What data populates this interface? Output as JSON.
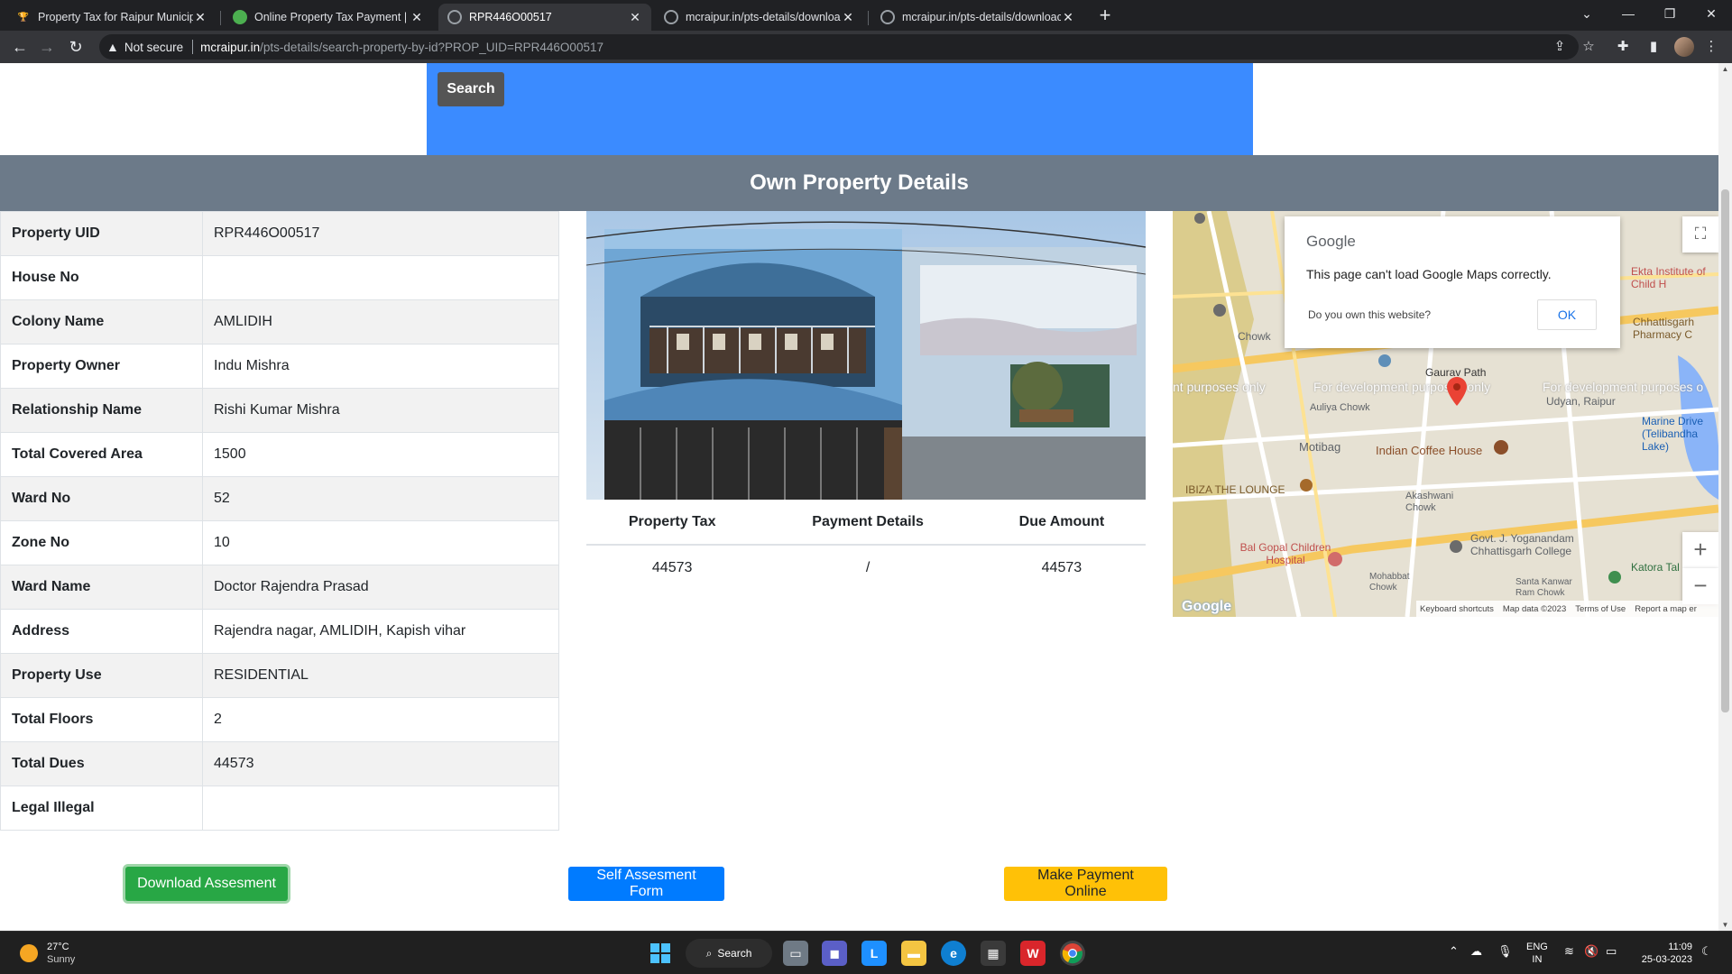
{
  "browser": {
    "tabs": [
      {
        "title": "Property Tax for Raipur Municipa",
        "active": false
      },
      {
        "title": "Online Property Tax Payment | D",
        "active": false
      },
      {
        "title": "RPR446O00517",
        "active": true
      },
      {
        "title": "mcraipur.in/pts-details/downloac",
        "active": false
      },
      {
        "title": "mcraipur.in/pts-details/downloac",
        "active": false
      }
    ],
    "security_label": "Not secure",
    "url_host": "mcraipur.in",
    "url_path": "/pts-details/search-property-by-id?PROP_UID=RPR446O00517"
  },
  "search": {
    "button_label": "Search"
  },
  "section_title": "Own Property Details",
  "details": [
    {
      "label": "Property UID",
      "value": "RPR446O00517"
    },
    {
      "label": "House No",
      "value": ""
    },
    {
      "label": "Colony Name",
      "value": "AMLIDIH"
    },
    {
      "label": "Property Owner",
      "value": "Indu Mishra"
    },
    {
      "label": "Relationship Name",
      "value": "Rishi Kumar Mishra"
    },
    {
      "label": "Total Covered Area",
      "value": "1500"
    },
    {
      "label": "Ward No",
      "value": "52"
    },
    {
      "label": "Zone No",
      "value": "10"
    },
    {
      "label": "Ward Name",
      "value": "Doctor Rajendra Prasad"
    },
    {
      "label": "Address",
      "value": "Rajendra nagar, AMLIDIH, Kapish vihar"
    },
    {
      "label": "Property Use",
      "value": "RESIDENTIAL"
    },
    {
      "label": "Total Floors",
      "value": "2"
    },
    {
      "label": "Total Dues",
      "value": "44573"
    },
    {
      "label": "Legal Illegal",
      "value": ""
    }
  ],
  "tax_table": {
    "headers": [
      "Property Tax",
      "Payment Details",
      "Due Amount"
    ],
    "row": [
      "44573",
      "/",
      "44573"
    ]
  },
  "map": {
    "dialog_brand": "Google",
    "dialog_message": "This page can't load Google Maps correctly.",
    "dialog_question": "Do you own this website?",
    "dialog_ok": "OK",
    "dev_text_1": "nt purposes only",
    "dev_text_2": "For development purposes only",
    "dev_text_3": "For development purposes o",
    "place_1": "Indian Coffee House",
    "place_2": "IBIZA THE LOUNGE",
    "place_3": "Motibag",
    "place_4": "Bal Gopal Children Hospital",
    "place_5": "Govt. J. Yoganandam Chhattisgarh College",
    "place_6": "Marine Drive (Telibandha Lake)",
    "place_7": "Udyan, Raipur",
    "place_8": "Gaurav Path",
    "place_9": "Auliya Chowk",
    "place_10": "Akashwani Chowk",
    "place_11": "Ekta Institute of Child H",
    "place_12": "Chhattisgarh Pharmacy C",
    "place_13": "Katora Tal",
    "place_14": "Chowk",
    "place_15": "Mohabbat Chowk",
    "place_16": "Santa Kanwar Ram Chowk",
    "logo": "Google",
    "footer": [
      "Keyboard shortcuts",
      "Map data ©2023",
      "Terms of Use",
      "Report a map er"
    ]
  },
  "actions": {
    "download": "Download Assesment",
    "self_form": "Self Assesment Form",
    "pay": "Make Payment Online"
  },
  "taskbar": {
    "temperature": "27°C",
    "weather": "Sunny",
    "search": "Search",
    "lang_1": "ENG",
    "lang_2": "IN",
    "time": "11:09",
    "date": "25-03-2023"
  },
  "colors": {
    "search_panel": "#3b8bff",
    "section_bar": "#6c7a89",
    "green_button": "#28a745",
    "blue_button": "#007bff",
    "yellow_button": "#ffc107"
  }
}
